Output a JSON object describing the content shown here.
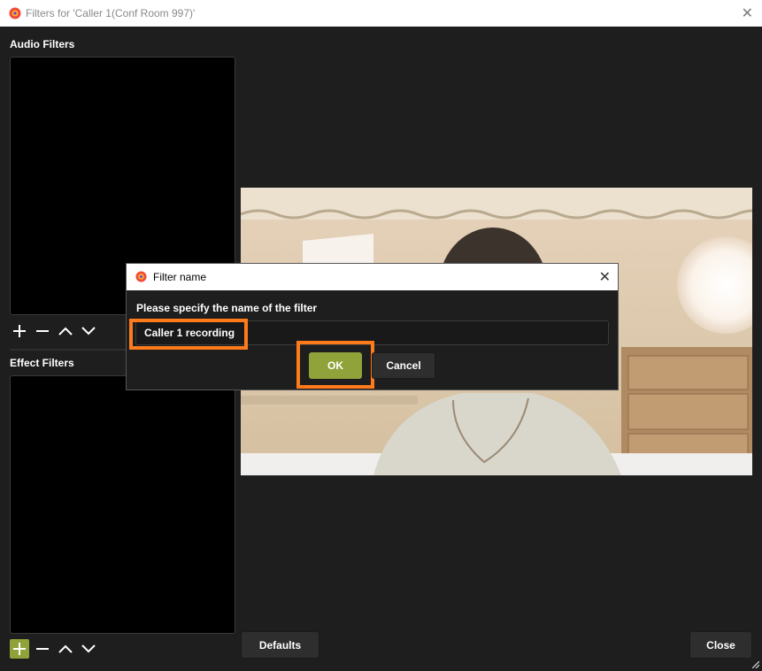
{
  "window": {
    "title": "Filters for 'Caller 1(Conf Room 997)'",
    "app_icon": "obs-logo-icon",
    "close_glyph": "✕"
  },
  "audio_filters": {
    "label": "Audio Filters",
    "items": []
  },
  "effect_filters": {
    "label": "Effect Filters",
    "items": []
  },
  "toolbar_icons": [
    "plus-icon",
    "minus-icon",
    "chevron-up-icon",
    "chevron-down-icon"
  ],
  "preview": {
    "content": "webcam-video-frame"
  },
  "buttons": {
    "defaults": "Defaults",
    "close": "Close"
  },
  "dialog": {
    "title": "Filter name",
    "close_glyph": "✕",
    "prompt": "Please specify the name of the filter",
    "input_value": "Caller 1 recording",
    "ok_label": "OK",
    "cancel_label": "Cancel"
  },
  "colors": {
    "accent_green": "#8fa33a",
    "highlight_orange": "#ff7a1a",
    "background": "#1e1e1e"
  }
}
